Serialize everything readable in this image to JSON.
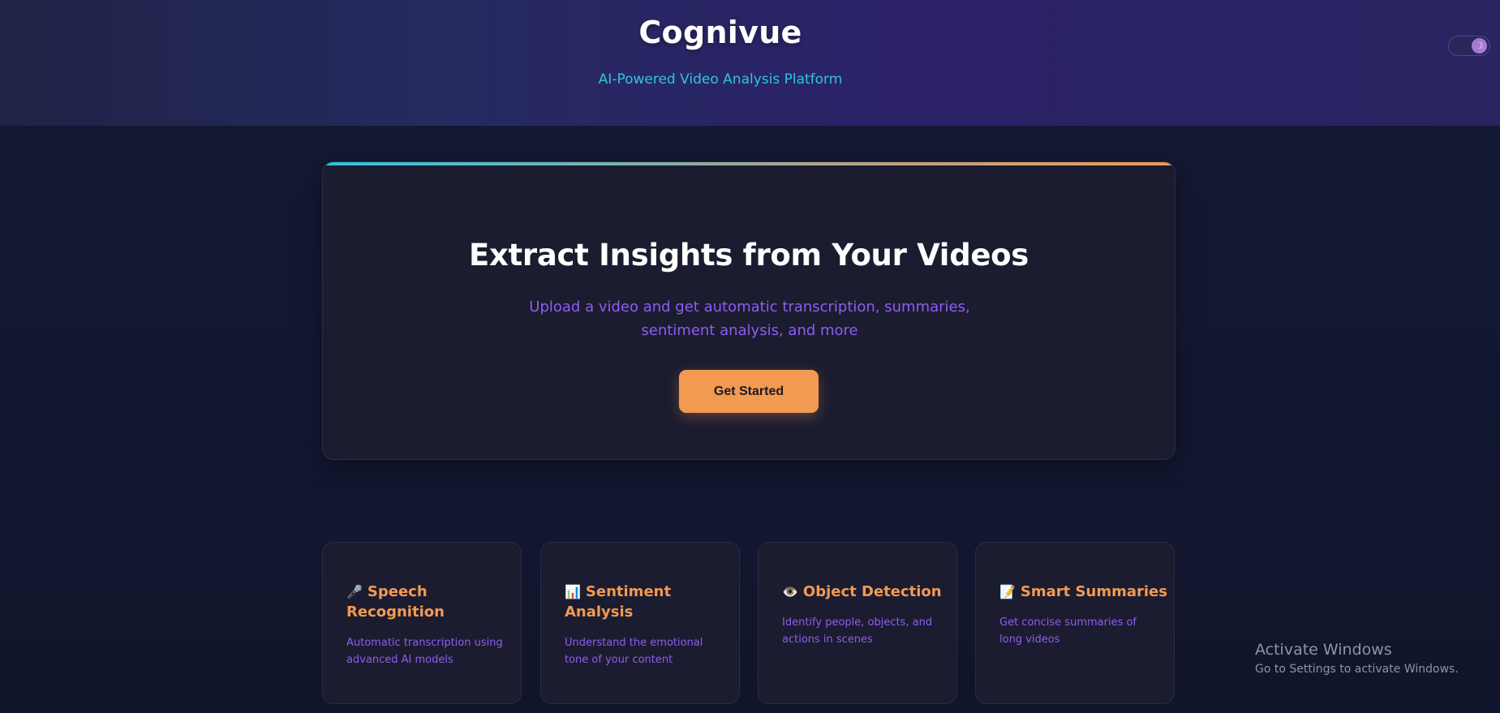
{
  "header": {
    "title": "Cognivue",
    "subtitle": "AI-Powered Video Analysis Platform",
    "theme_toggle_icon": "moon-icon"
  },
  "hero": {
    "title": "Extract Insights from Your Videos",
    "description": "Upload a video and get automatic transcription, summaries, sentiment analysis, and more",
    "cta_label": "Get Started"
  },
  "features": [
    {
      "icon": "🎤",
      "icon_name": "microphone-icon",
      "title": "Speech Recognition",
      "description": "Automatic transcription using advanced AI models"
    },
    {
      "icon": "📊",
      "icon_name": "bar-chart-icon",
      "title": "Sentiment Analysis",
      "description": "Understand the emotional tone of your content"
    },
    {
      "icon": "👁️",
      "icon_name": "eye-icon",
      "title": "Object Detection",
      "description": "Identify people, objects, and actions in scenes"
    },
    {
      "icon": "📝",
      "icon_name": "memo-icon",
      "title": "Smart Summaries",
      "description": "Get concise summaries of long videos"
    }
  ],
  "os_watermark": {
    "title": "Activate Windows",
    "subtitle": "Go to Settings to activate Windows."
  },
  "colors": {
    "accent_orange": "#f29a52",
    "accent_cyan": "#2ec5e0",
    "accent_purple": "#8f5cf2",
    "card_bg": "#1b1c2f",
    "page_bg": "#121830"
  }
}
